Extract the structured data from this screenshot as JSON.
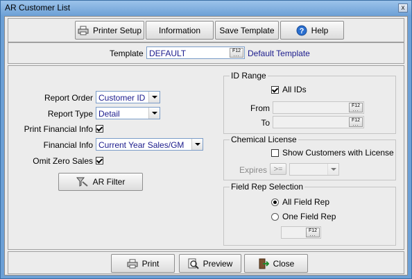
{
  "window": {
    "title": "AR Customer List",
    "close_glyph": "x"
  },
  "toolbar": {
    "printer_setup": "Printer Setup",
    "information": "Information",
    "save_template": "Save Template",
    "help": "Help"
  },
  "template": {
    "label": "Template",
    "value": "DEFAULT",
    "f12": "F12",
    "description": "Default Template"
  },
  "options": {
    "report_order_label": "Report Order",
    "report_order_value": "Customer ID",
    "report_type_label": "Report Type",
    "report_type_value": "Detail",
    "print_financial_label": "Print Financial Info",
    "print_financial_checked": true,
    "financial_info_label": "Financial Info",
    "financial_info_value": "Current Year Sales/GM",
    "omit_zero_label": "Omit Zero Sales",
    "omit_zero_checked": true,
    "ar_filter": "AR Filter"
  },
  "id_range": {
    "title": "ID Range",
    "all_ids_label": "All IDs",
    "all_ids_checked": true,
    "from_label": "From",
    "to_label": "To",
    "f12": "F12"
  },
  "chemical_license": {
    "title": "Chemical License",
    "show_label": "Show Customers with License",
    "expires_label": "Expires",
    "compare_value": ">="
  },
  "field_rep": {
    "title": "Field Rep Selection",
    "all_label": "All Field Rep",
    "one_label": "One Field Rep",
    "selected": "all",
    "f12": "F12"
  },
  "footer": {
    "print": "Print",
    "preview": "Preview",
    "close": "Close"
  },
  "colors": {
    "accent_text": "#1a1a8c",
    "titlebar": "#6ca0d6"
  }
}
